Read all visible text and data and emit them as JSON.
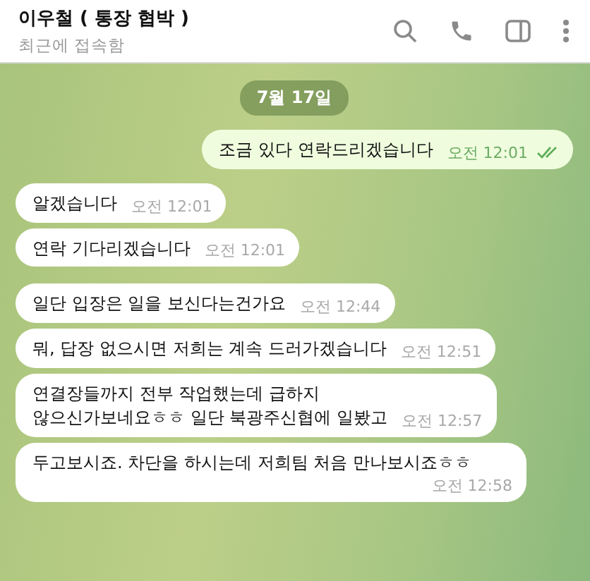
{
  "header": {
    "title": "이우철 ( 통장 협박 )",
    "status": "최근에 접속함"
  },
  "date_badge": "7월 17일",
  "messages": [
    {
      "kind": "out",
      "text": "조금 있다 연락드리겠습니다",
      "time": "오전 12:01",
      "read": true
    },
    {
      "kind": "in",
      "text": "알겠습니다",
      "time": "오전 12:01"
    },
    {
      "kind": "in",
      "text": "연락 기다리겠습니다",
      "time": "오전 12:01"
    },
    {
      "kind": "in",
      "text": "일단 입장은 일을 보신다는건가요",
      "time": "오전 12:44"
    },
    {
      "kind": "in",
      "text": "뭐, 답장 없으시면 저희는 계속 드러가겠습니다",
      "time": "오전 12:51"
    },
    {
      "kind": "in",
      "text": "연결장들까지 전부 작업했는데 급하지\n않으신가보네요ㅎㅎ 일단 북광주신협에 일봤고",
      "time": "오전 12:57"
    },
    {
      "kind": "in",
      "text": "두고보시죠. 차단을 하시는데 저희팀 처음 만나보시죠ㅎㅎ",
      "time": "오전 12:58"
    }
  ]
}
